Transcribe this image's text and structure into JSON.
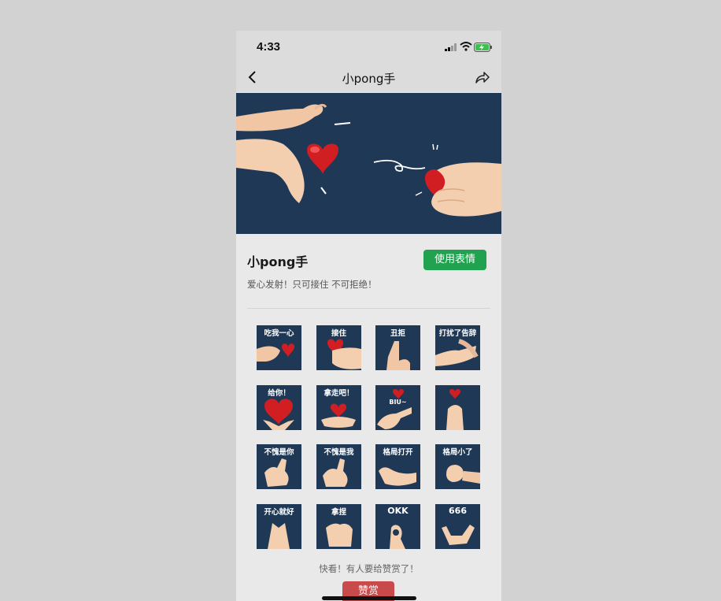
{
  "status_bar": {
    "time": "4:33"
  },
  "nav": {
    "title": "小pong手",
    "back_icon": "chevron-left-icon",
    "share_icon": "share-icon"
  },
  "pack": {
    "title": "小pong手",
    "use_label": "使用表情",
    "description": "爱心发射！只可接住 不可拒绝！",
    "accent_color": "#20a24e"
  },
  "stickers": [
    {
      "label": "吃我一心"
    },
    {
      "label": "接住"
    },
    {
      "label": "丑拒"
    },
    {
      "label": "打扰了告辞"
    },
    {
      "label": "给你！"
    },
    {
      "label": "拿走吧！"
    },
    {
      "label": ""
    },
    {
      "label": ""
    },
    {
      "label": "不愧是你"
    },
    {
      "label": "不愧是我"
    },
    {
      "label": "格局打开"
    },
    {
      "label": "格局小了"
    },
    {
      "label": "开心就好"
    },
    {
      "label": "拿捏"
    },
    {
      "label": "OKK"
    },
    {
      "label": "666"
    }
  ],
  "sticker_biu": "BIU~",
  "reward": {
    "prompt": "快看！有人要给赞赏了！",
    "button_label": "赞赏",
    "button_color": "#c94a4a"
  }
}
